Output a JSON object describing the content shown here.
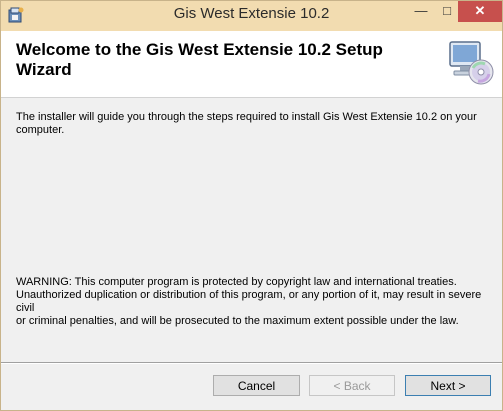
{
  "window": {
    "title": "Gis West Extensie 10.2",
    "minimize_glyph": "—",
    "maximize_glyph": "□",
    "close_glyph": "✕",
    "icons": [
      "installer-app-icon",
      "setup-computer-disc-icon"
    ]
  },
  "header": {
    "title_line1": "Welcome to the Gis West Extensie 10.2 Setup",
    "title_line2": "Wizard"
  },
  "content": {
    "intro_line1": "The installer will guide you through the steps required to install Gis West Extensie 10.2 on your",
    "intro_line2": "computer.",
    "warning_line1": "WARNING: This computer program is protected by copyright law and international treaties.",
    "warning_line2": "Unauthorized duplication or distribution of this program, or any portion of it, may result in severe civil",
    "warning_line3": "or criminal penalties, and will be prosecuted to the maximum extent possible under the law."
  },
  "buttons": {
    "cancel": "Cancel",
    "back": "< Back",
    "next": "Next >"
  }
}
